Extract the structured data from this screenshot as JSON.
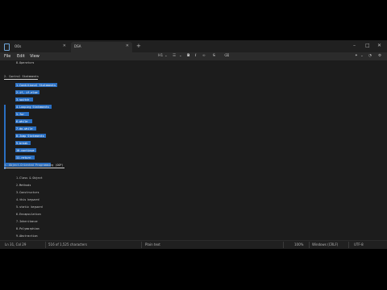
{
  "tabs": [
    {
      "label": "OOs",
      "active": false
    },
    {
      "label": "DSA",
      "active": true
    }
  ],
  "menu": [
    "File",
    "Edit",
    "View"
  ],
  "toolbar": {
    "heading_label": "H1",
    "bold_label": "B",
    "italic_label": "I"
  },
  "editor": {
    "lines_top": [
      "8.Operators"
    ],
    "heading": "2. Control Statements",
    "selected_items": [
      "1.Conditional Statements",
      "2.if, if-else",
      "3.switch",
      "4.Looping Statements",
      "5.for",
      "6.while",
      "7.do-while",
      "8.Jump Statements",
      "9.break",
      "10.continue",
      "11.return"
    ],
    "oop_heading": "3. Object-Oriented Programming (OOP)",
    "items": [
      "1.Class & Object",
      "2.Methods",
      "3.Constructors",
      "4.this keyword",
      "5.static keyword",
      "6.Encapsulation",
      "7.Inheritance",
      "8.Polymorphism",
      "9.Abstraction"
    ]
  },
  "status": {
    "position": "Ln 31, Col 29",
    "selection": "516 of 1,525 characters",
    "format": "Plain text",
    "zoom": "100%",
    "line_ending": "Windows (CRLF)",
    "encoding": "UTF-8"
  },
  "colors": {
    "selection": "#2a6fc2",
    "background": "#1c1c1c",
    "chrome": "#202020"
  }
}
